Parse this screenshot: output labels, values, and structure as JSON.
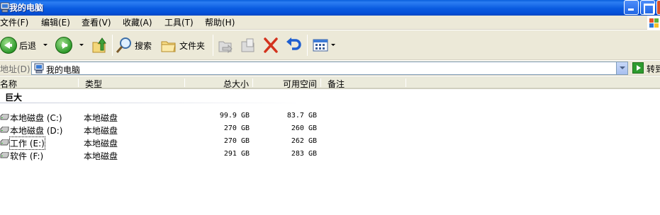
{
  "window": {
    "title": "我的电脑"
  },
  "menu": [
    "文件(F)",
    "编辑(E)",
    "查看(V)",
    "收藏(A)",
    "工具(T)",
    "帮助(H)"
  ],
  "toolbar": {
    "back": "后退",
    "search": "搜索",
    "folders": "文件夹"
  },
  "address": {
    "label": "地址(D)",
    "value": "我的电脑",
    "go": "转到"
  },
  "columns": {
    "name": "名称",
    "type": "类型",
    "total": "总大小",
    "free": "可用空间",
    "comment": "备注"
  },
  "group": {
    "title": "巨大"
  },
  "drives": [
    {
      "name": "本地磁盘 (C:)",
      "type": "本地磁盘",
      "total": "99.9 GB",
      "free": "83.7 GB"
    },
    {
      "name": "本地磁盘 (D:)",
      "type": "本地磁盘",
      "total": "270 GB",
      "free": "260 GB"
    },
    {
      "name": "工作 (E:)",
      "type": "本地磁盘",
      "total": "270 GB",
      "free": "262 GB"
    },
    {
      "name": "软件 (F:)",
      "type": "本地磁盘",
      "total": "291 GB",
      "free": "283 GB"
    }
  ],
  "colors": {
    "titlebar": "#0a5be0",
    "chrome": "#ece9d8",
    "close_button": "#d8522c"
  }
}
